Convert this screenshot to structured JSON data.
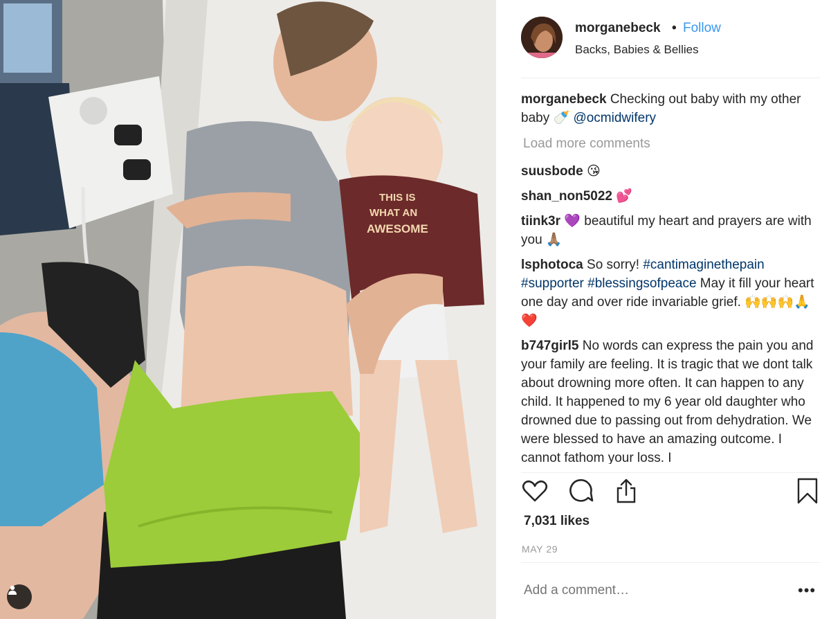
{
  "post": {
    "username": "morganebeck",
    "separator": "•",
    "follow_label": "Follow",
    "location": "Backs, Babies & Bellies",
    "caption_user": "morganebeck",
    "caption_text_1": "Checking out baby with my other baby",
    "caption_emoji": "🍼",
    "caption_mention": "@ocmidwifery",
    "load_more": "Load more comments",
    "likes": "7,031 likes",
    "date": "MAY 29",
    "add_comment_placeholder": "Add a comment…",
    "options": "•••",
    "shirt_text": "THIS IS WHAT AN AWESOME SISTER"
  },
  "comments": [
    {
      "user": "suusbode",
      "text": "😘"
    },
    {
      "user": "shan_non5022",
      "text": "💕"
    },
    {
      "user": "tiink3r",
      "text": "💜 beautiful my heart and prayers are with you 🙏🏽"
    },
    {
      "user": "lsphotoca",
      "text_1": "So sorry!",
      "tag1": "#cantimaginethepain",
      "tag2": "#supporter",
      "tag3": "#blessingsofpeace",
      "text_2": "May it fill your heart one day and over ride invariable grief. 🙌🙌🙌🙏❤️"
    },
    {
      "user": "b747girl5",
      "text": "No words can express the pain you and your family are feeling. It is tragic that we dont talk about drowning more often. It can happen to any child. It happened to my 6 year old daughter who drowned due to passing out from dehydration. We were blessed to have an amazing outcome. I cannot fathom your loss. I"
    }
  ],
  "icons": {
    "like": "heart-icon",
    "comment": "comment-bubble-icon",
    "share": "share-icon",
    "save": "bookmark-icon",
    "tagged_user": "user-tag-icon"
  },
  "colors": {
    "link": "#3897f0",
    "hashtag": "#003569",
    "muted": "#999999",
    "towel": "#9ccc3a"
  }
}
